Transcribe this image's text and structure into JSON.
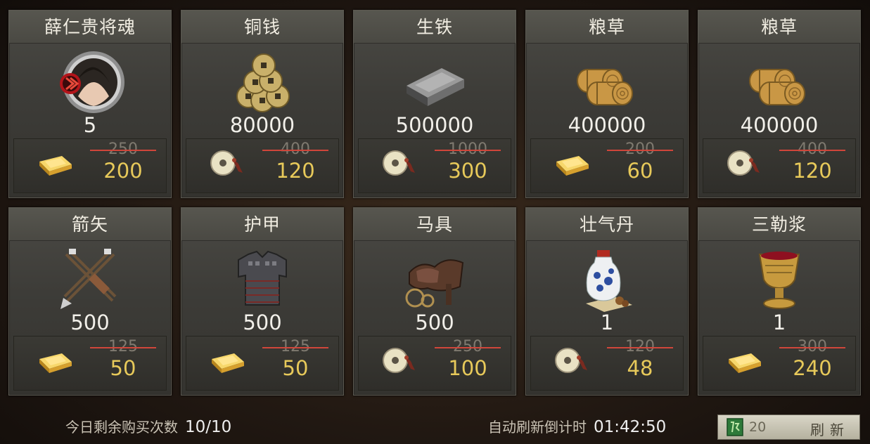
{
  "shop": {
    "items": [
      {
        "name": "薛仁贵将魂",
        "qty": "5",
        "old_price": "250",
        "new_price": "200",
        "currency": "gold-ingot-icon",
        "icon": "general-soul-portrait-icon"
      },
      {
        "name": "铜钱",
        "qty": "80000",
        "old_price": "400",
        "new_price": "120",
        "currency": "jade-coin-icon",
        "icon": "copper-coins-icon"
      },
      {
        "name": "生铁",
        "qty": "500000",
        "old_price": "1000",
        "new_price": "300",
        "currency": "jade-coin-icon",
        "icon": "iron-ingot-icon"
      },
      {
        "name": "粮草",
        "qty": "400000",
        "old_price": "200",
        "new_price": "60",
        "currency": "gold-ingot-icon",
        "icon": "hay-bales-icon"
      },
      {
        "name": "粮草",
        "qty": "400000",
        "old_price": "400",
        "new_price": "120",
        "currency": "jade-coin-icon",
        "icon": "hay-bales-icon"
      },
      {
        "name": "箭矢",
        "qty": "500",
        "old_price": "125",
        "new_price": "50",
        "currency": "gold-ingot-icon",
        "icon": "arrows-quiver-icon"
      },
      {
        "name": "护甲",
        "qty": "500",
        "old_price": "125",
        "new_price": "50",
        "currency": "gold-ingot-icon",
        "icon": "armor-icon"
      },
      {
        "name": "马具",
        "qty": "500",
        "old_price": "250",
        "new_price": "100",
        "currency": "jade-coin-icon",
        "icon": "saddle-icon"
      },
      {
        "name": "壮气丹",
        "qty": "1",
        "old_price": "120",
        "new_price": "48",
        "currency": "jade-coin-icon",
        "icon": "porcelain-vase-pills-icon"
      },
      {
        "name": "三勒浆",
        "qty": "1",
        "old_price": "300",
        "new_price": "240",
        "currency": "gold-ingot-icon",
        "icon": "wine-goblet-icon"
      }
    ]
  },
  "footer": {
    "purchases_label": "今日剩余购买次数",
    "purchases_value": "10/10",
    "timer_label": "自动刷新倒计时",
    "timer_value": "01:42:50",
    "refresh_cost": "20",
    "refresh_label": "刷新",
    "refresh_icon": "green-token-icon"
  },
  "colors": {
    "new_price": "#e7c95a",
    "strike": "#d0463a",
    "title_text": "#f1ede2"
  }
}
